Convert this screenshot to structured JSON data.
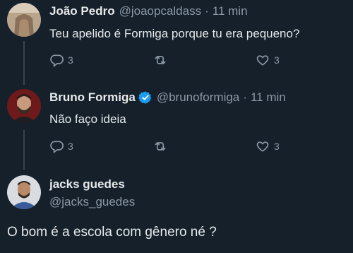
{
  "tweets": [
    {
      "name": "João Pedro",
      "handle": "@joaopcaldass",
      "separator": "·",
      "time": "11 min",
      "text": "Teu apelido é Formiga porque tu era pequeno?",
      "replies": "3",
      "likes": "3",
      "verified": false
    },
    {
      "name": "Bruno Formiga",
      "handle": "@brunoformiga",
      "separator": "·",
      "time": "11 min",
      "text": "Não faço ideia",
      "replies": "3",
      "likes": "3",
      "verified": true
    }
  ],
  "reply": {
    "name": "jacks guedes",
    "handle": "@jacks_guedes",
    "text": "O bom é a escola com gênero né ?"
  },
  "icons": {
    "reply": "speech-bubble-icon",
    "retweet": "retweet-icon",
    "like": "heart-icon",
    "verified": "verified-badge-icon"
  },
  "colors": {
    "background": "#15202b",
    "text": "#e7e9ea",
    "secondary": "#8b98a5",
    "thread_line": "#38444d",
    "verified": "#1d9bf0"
  }
}
